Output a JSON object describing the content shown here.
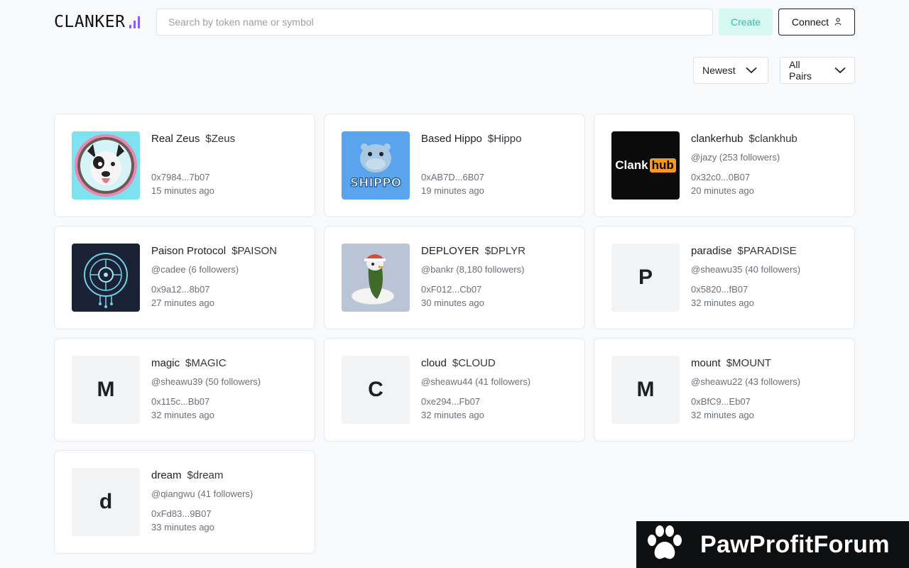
{
  "header": {
    "logo_text": "CLANKER",
    "search_placeholder": "Search by token name or symbol",
    "create_label": "Create",
    "connect_label": "Connect",
    "accent_color": "#8b5cf6"
  },
  "filters": {
    "sort_value": "Newest",
    "pairs_value": "All Pairs"
  },
  "tokens": [
    {
      "name": "Real Zeus",
      "symbol": "$Zeus",
      "creator": "",
      "address": "0x7984...7b07",
      "time": "15 minutes ago",
      "thumb": "dog-avatar"
    },
    {
      "name": "Based Hippo",
      "symbol": "$Hippo",
      "creator": "",
      "address": "0xAB7D...6B07",
      "time": "19 minutes ago",
      "thumb": "hippo-avatar"
    },
    {
      "name": "clankerhub",
      "symbol": "$clankhub",
      "creator": "@jazy (253 followers)",
      "address": "0x32c0...0B07",
      "time": "20 minutes ago",
      "thumb": "clankhub-logo"
    },
    {
      "name": "Paison Protocol",
      "symbol": "$PAISON",
      "creator": "@cadee (6 followers)",
      "address": "0x9a12...8b07",
      "time": "27 minutes ago",
      "thumb": "circuit-avatar"
    },
    {
      "name": "DEPLOYER",
      "symbol": "$DPLYR",
      "creator": "@bankr (8,180 followers)",
      "address": "0xF012...Cb07",
      "time": "30 minutes ago",
      "thumb": "penguin-avatar"
    },
    {
      "name": "paradise",
      "symbol": "$PARADISE",
      "creator": "@sheawu35 (40 followers)",
      "address": "0x5820...fB07",
      "time": "32 minutes ago",
      "letter": "P"
    },
    {
      "name": "magic",
      "symbol": "$MAGIC",
      "creator": "@sheawu39 (50 followers)",
      "address": "0x115c...Bb07",
      "time": "32 minutes ago",
      "letter": "M"
    },
    {
      "name": "cloud",
      "symbol": "$CLOUD",
      "creator": "@sheawu44 (41 followers)",
      "address": "0xe294...Fb07",
      "time": "32 minutes ago",
      "letter": "C"
    },
    {
      "name": "mount",
      "symbol": "$MOUNT",
      "creator": "@sheawu22 (43 followers)",
      "address": "0xBfC9...Eb07",
      "time": "32 minutes ago",
      "letter": "M"
    },
    {
      "name": "dream",
      "symbol": "$dream",
      "creator": "@qiangwu (41 followers)",
      "address": "0xFd83...9B07",
      "time": "33 minutes ago",
      "letter": "d"
    }
  ],
  "clankhub_logo": {
    "word1": "Clank",
    "word2": "hub"
  },
  "hippo_logo_text": "SHIPPO",
  "watermark": {
    "text": "PawProfitForum"
  }
}
